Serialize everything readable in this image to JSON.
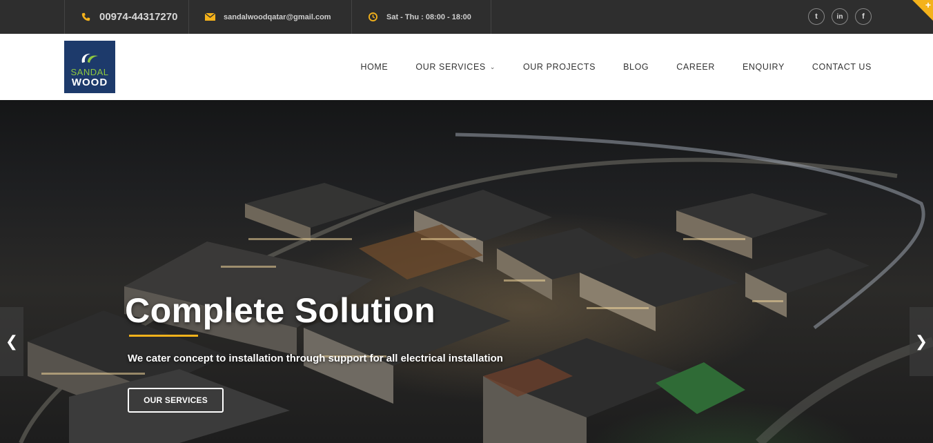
{
  "topbar": {
    "phone": "00974-44317270",
    "email": "sandalwoodqatar@gmail.com",
    "hours": "Sat - Thu : 08:00 - 18:00",
    "social": [
      {
        "icon": "twitter-icon",
        "glyph": "t"
      },
      {
        "icon": "linkedin-icon",
        "glyph": "in"
      },
      {
        "icon": "facebook-icon",
        "glyph": "f"
      }
    ]
  },
  "logo": {
    "line1": "SANDAL",
    "line2": "WOOD"
  },
  "nav": {
    "items": [
      {
        "label": "HOME"
      },
      {
        "label": "OUR SERVICES"
      },
      {
        "label": "OUR PROJECTS"
      },
      {
        "label": "BLOG"
      },
      {
        "label": "CAREER"
      },
      {
        "label": "ENQUIRY"
      },
      {
        "label": "CONTACT US"
      }
    ]
  },
  "hero": {
    "title": "Complete Solution",
    "subtitle": "We cater concept to installation through support for all electrical installation",
    "button": "OUR SERVICES",
    "prev_glyph": "❮",
    "next_glyph": "❯"
  },
  "colors": {
    "accent": "#f4b21b",
    "topbar_bg": "#2e2e2e",
    "logo_bg": "#1d3a6b",
    "logo_green": "#8fc83f"
  }
}
